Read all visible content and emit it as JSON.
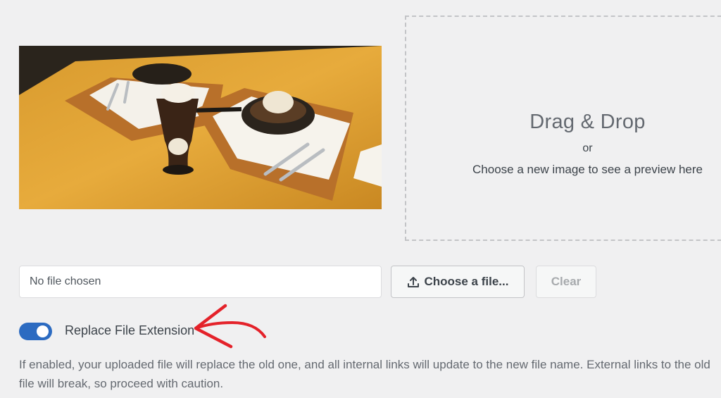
{
  "preview": {
    "image_alt": "Desserts with ice cream sundae on a wooden table"
  },
  "dropzone": {
    "title": "Drag & Drop",
    "or_text": "or",
    "hint": "Choose a new image to see a preview here"
  },
  "file_input": {
    "value": "No file chosen"
  },
  "buttons": {
    "choose_label": "Choose a file...",
    "choose_icon": "upload-icon",
    "clear_label": "Clear"
  },
  "replace_extension": {
    "label": "Replace File Extension",
    "enabled": true,
    "help": "If enabled, your uploaded file will replace the old one, and all internal links will update to the new file name. External links to the old file will break, so proceed with caution."
  },
  "colors": {
    "toggle_on": "#2c6bc1",
    "annotation_arrow": "#e4222a",
    "page_background": "#f0f0f1"
  }
}
